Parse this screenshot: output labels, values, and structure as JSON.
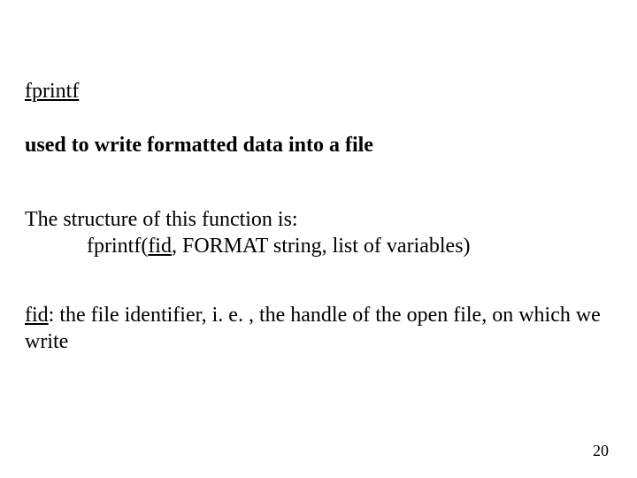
{
  "title": "fprintf",
  "subtitle": "used to write formatted data into a file",
  "structure_intro": "The structure of this function is:",
  "structure_line_before_fid": "fprintf(",
  "structure_fid": "fid",
  "structure_line_after_fid": ", FORMAT string, list of variables)",
  "fid_label": "fid",
  "fid_desc": ": the file identifier, i. e. , the handle of the open file, on which we write",
  "page_number": "20"
}
